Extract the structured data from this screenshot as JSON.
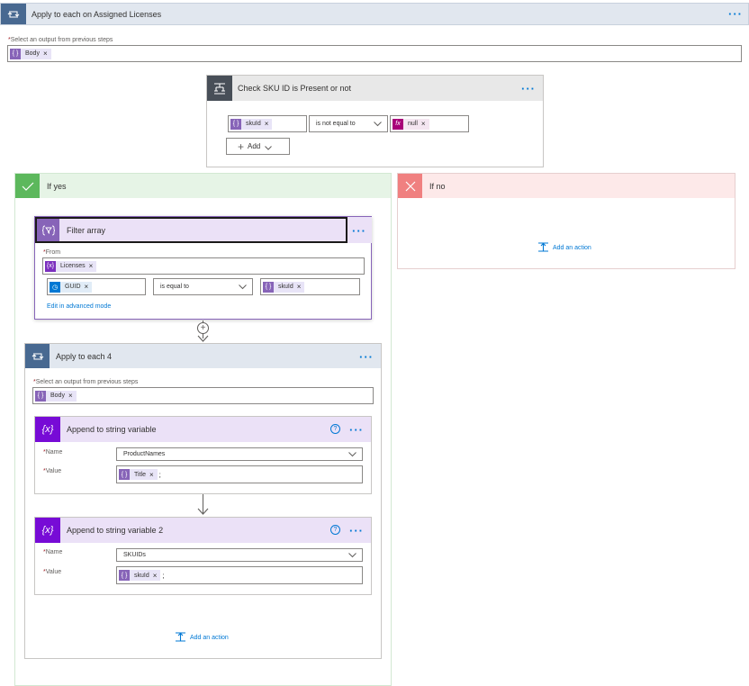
{
  "outer_loop": {
    "title": "Apply to each on Assigned Licenses",
    "select_label": "Select an output from previous steps",
    "token": "Body"
  },
  "condition": {
    "title": "Check SKU ID is Present or not",
    "left_token": "skuId",
    "operator": "is not equal to",
    "right_token": "null",
    "add_label": "Add"
  },
  "if_yes": {
    "title": "If yes"
  },
  "if_no": {
    "title": "If no",
    "add_action": "Add an action"
  },
  "filter_array": {
    "title": "Filter array",
    "from_label": "From",
    "from_token": "Licenses",
    "left_token": "GUID",
    "operator": "is equal to",
    "right_token": "skuId",
    "advanced_link": "Edit in advanced mode"
  },
  "inner_loop": {
    "title": "Apply to each 4",
    "select_label": "Select an output from previous steps",
    "token": "Body",
    "add_action": "Add an action"
  },
  "append1": {
    "title": "Append to string variable",
    "name_label": "Name",
    "name_value": "ProductNames",
    "value_label": "Value",
    "value_token": "Title",
    "value_suffix": ";"
  },
  "append2": {
    "title": "Append to string variable 2",
    "name_label": "Name",
    "name_value": "SKUIDs",
    "value_label": "Value",
    "value_token": "skuId",
    "value_suffix": ";"
  },
  "colors": {
    "loop_header": "#e1e7ef",
    "loop_icon": "#486991",
    "condition_header": "#e8e8e8",
    "condition_icon": "#484f58",
    "yes_header": "#e6f4e6",
    "yes_icon": "#5cb85c",
    "no_header": "#fde9e9",
    "no_icon": "#f08080",
    "variable_header": "#ebe1f7",
    "variable_icon": "#770bd6",
    "link": "#0078d4"
  }
}
